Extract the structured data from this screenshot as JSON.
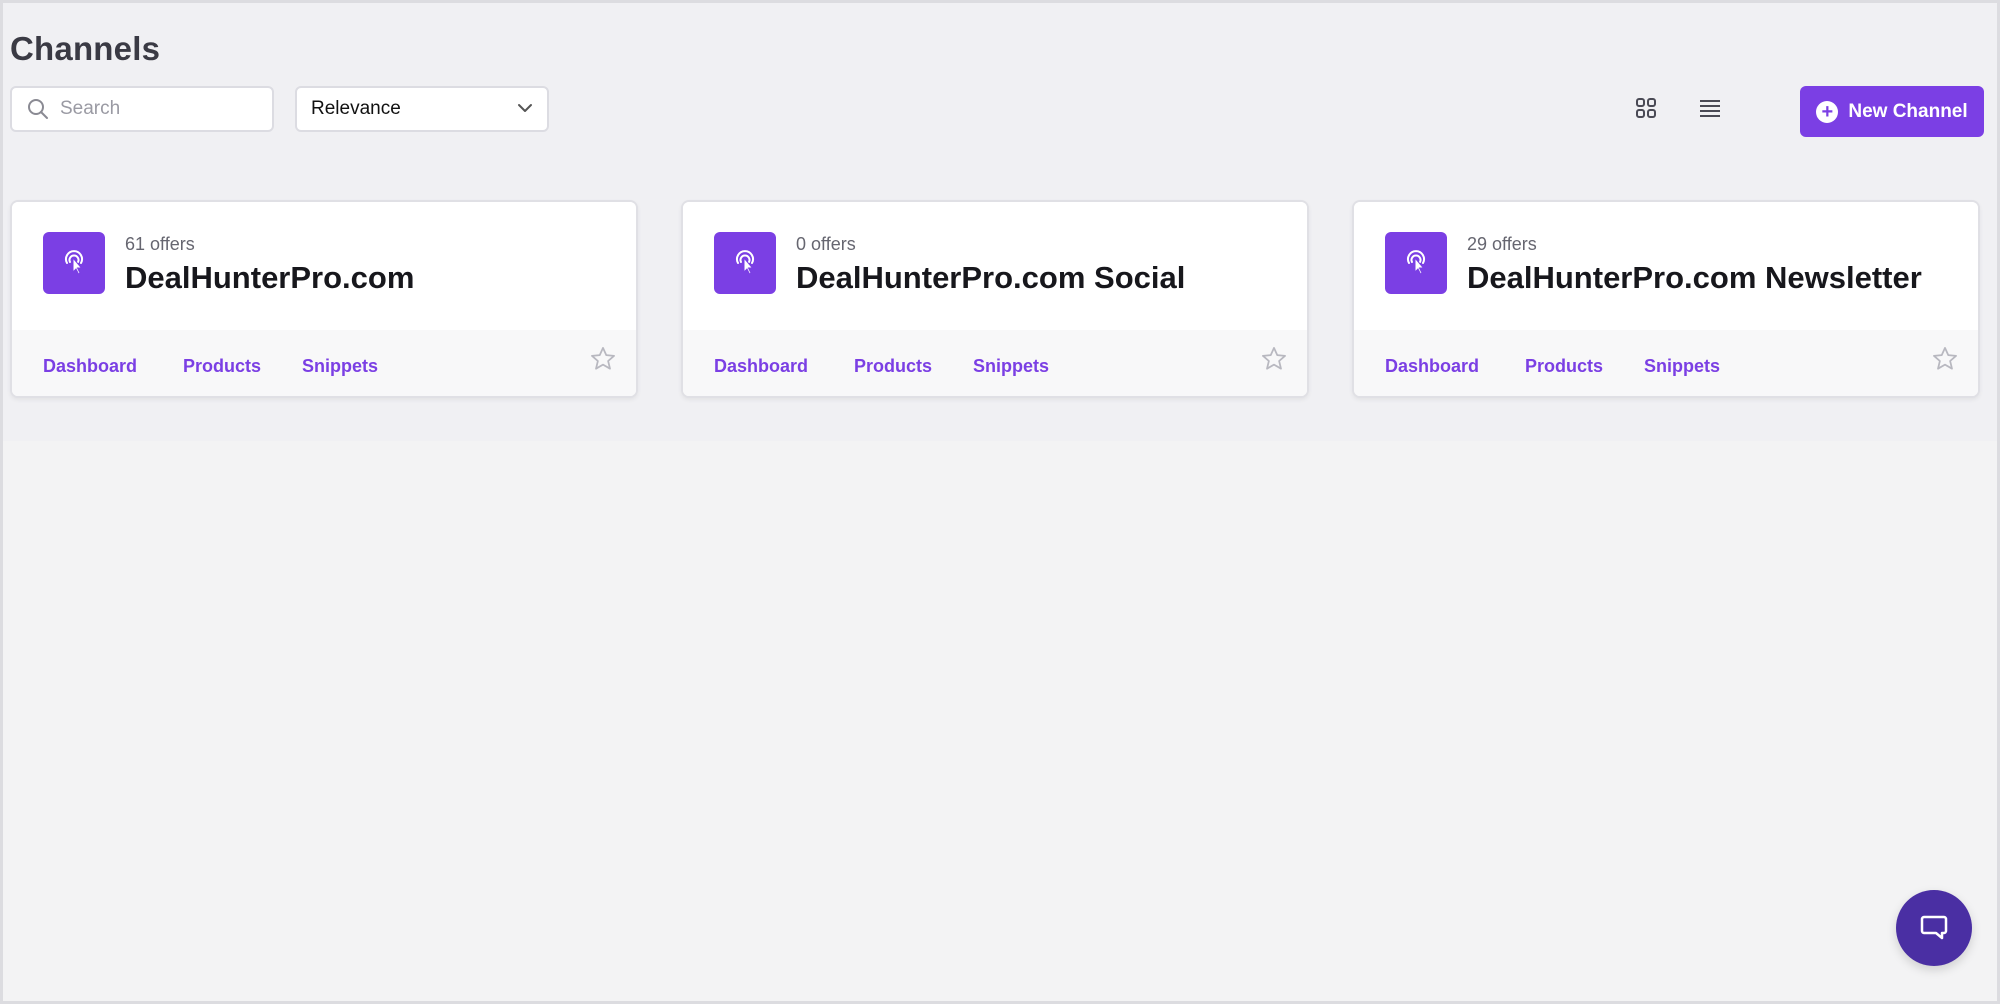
{
  "header": {
    "title": "Channels"
  },
  "toolbar": {
    "search_placeholder": "Search",
    "search_value": "",
    "sort_value": "Relevance",
    "new_channel_label": "New Channel",
    "icons": {
      "search": "search-icon",
      "sort_chevron": "chevron-down-icon",
      "grid_view": "grid-view-icon",
      "list_view": "list-view-icon",
      "new_channel": "plus-circle-icon"
    }
  },
  "channels": [
    {
      "offers": "61 offers",
      "name": "DealHunterPro.com",
      "links": [
        "Dashboard",
        "Products",
        "Snippets"
      ]
    },
    {
      "offers": "0 offers",
      "name": "DealHunterPro.com Social",
      "links": [
        "Dashboard",
        "Products",
        "Snippets"
      ]
    },
    {
      "offers": "29 offers",
      "name": "DealHunterPro.com Newsletter",
      "links": [
        "Dashboard",
        "Products",
        "Snippets"
      ]
    }
  ],
  "chat": {
    "icon": "chat-bubble-icon"
  },
  "colors": {
    "accent": "#7b3fe4",
    "chat_button": "#4a2fa3",
    "background": "#f3f3f4",
    "card_footer": "#f8f8f9"
  }
}
